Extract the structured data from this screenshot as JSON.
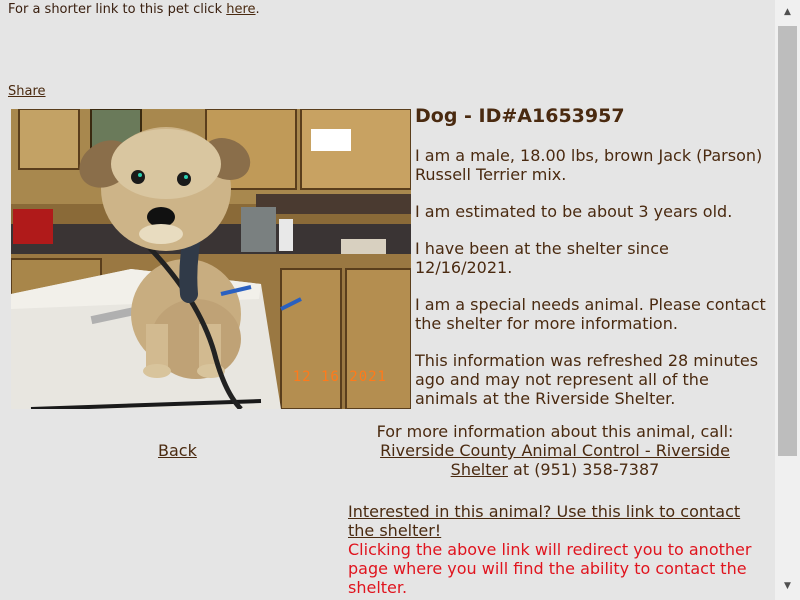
{
  "short_link": {
    "text": "For a shorter link to this pet click ",
    "link": "here",
    "after": "."
  },
  "share_label": "Share",
  "photo": {
    "stamp": "12 16 2021"
  },
  "pet": {
    "title": "Dog - ID#A1653957",
    "description": "I am a male, 18.00 lbs, brown Jack (Parson) Russell Terrier mix.",
    "age": "I am estimated to be about 3 years old.",
    "since": "I have been at the shelter since 12/16/2021.",
    "special_needs": "I am a special needs animal. Please contact the shelter for more information.",
    "refresh_note": "This information was refreshed 28 minutes ago and may not represent all of the animals at the Riverside Shelter."
  },
  "back_label": "Back",
  "contact": {
    "intro": "For more information about this animal, call:",
    "shelter_link": "Riverside County Animal Control - Riverside Shelter",
    "phone_text": " at (951) 358-7387"
  },
  "interest": {
    "link": "Interested in this animal? Use this link to contact the shelter!",
    "warning": "Clicking the above link will redirect you to another page where you will find the ability to contact the shelter."
  },
  "colors": {
    "background": "#e5e5e5",
    "text": "#4a2a10",
    "warning": "#e0141e"
  },
  "icons": {
    "scroll_up": "triangle-up",
    "scroll_down": "triangle-down"
  }
}
